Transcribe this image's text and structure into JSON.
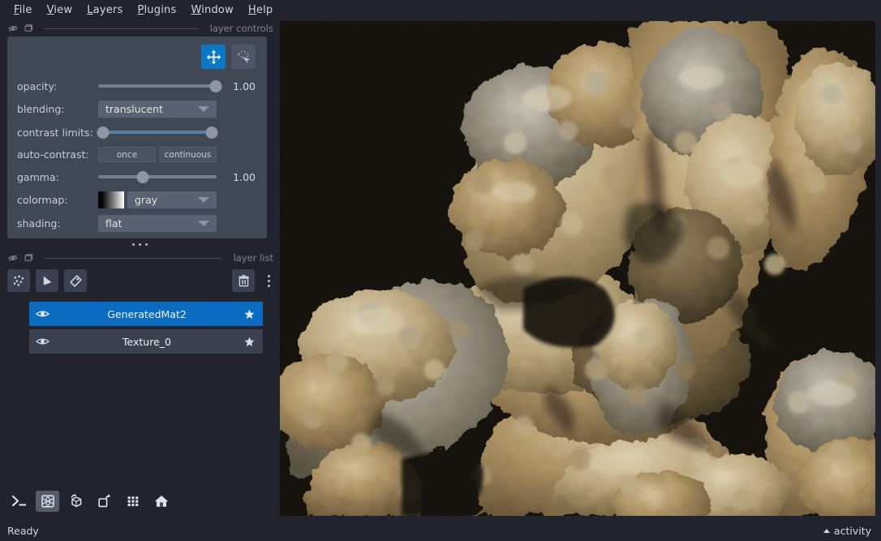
{
  "app": {
    "status_left": "Ready",
    "activity_label": "activity",
    "accent_blue": "#0a7ac7",
    "selected_blue": "#0a6cc0",
    "panel_bg": "#414855",
    "window_bg": "#21242c"
  },
  "menubar": {
    "items": [
      {
        "label": "File",
        "mnemonic": "F",
        "rest": "ile"
      },
      {
        "label": "View",
        "mnemonic": "V",
        "rest": "iew"
      },
      {
        "label": "Layers",
        "mnemonic": "L",
        "rest": "ayers"
      },
      {
        "label": "Plugins",
        "mnemonic": "P",
        "rest": "lugins"
      },
      {
        "label": "Window",
        "mnemonic": "W",
        "rest": "indow"
      },
      {
        "label": "Help",
        "mnemonic": "H",
        "rest": "elp"
      }
    ]
  },
  "layer_controls": {
    "dock_title": "layer controls",
    "dock_icons": [
      "float-window-icon",
      "dock-window-icon"
    ],
    "modes": [
      {
        "name": "pan-zoom-mode-button",
        "icon": "move-arrows-icon",
        "active": true
      },
      {
        "name": "transform-mode-button",
        "icon": "transform-select-icon",
        "active": false
      }
    ],
    "opacity": {
      "label": "opacity:",
      "value": "1.00",
      "fraction": 1.0
    },
    "blending": {
      "label": "blending:",
      "value": "translucent"
    },
    "contrast_limits": {
      "label": "contrast limits:",
      "low_fraction": 0.0,
      "high_fraction": 1.0
    },
    "auto_contrast": {
      "label": "auto-contrast:",
      "once": "once",
      "continuous": "continuous"
    },
    "gamma": {
      "label": "gamma:",
      "value": "1.00",
      "fraction": 0.375
    },
    "colormap": {
      "label": "colormap:",
      "value": "gray"
    },
    "shading": {
      "label": "shading:",
      "value": "flat"
    }
  },
  "layer_list": {
    "dock_title": "layer list",
    "dock_icons": [
      "float-window-icon",
      "dock-window-icon"
    ],
    "toolbar": [
      {
        "name": "new-points-layer-button",
        "icon": "points-icon"
      },
      {
        "name": "new-shapes-layer-button",
        "icon": "shapes-icon"
      },
      {
        "name": "new-labels-layer-button",
        "icon": "labels-tag-icon"
      }
    ],
    "delete_button": {
      "name": "delete-layer-button",
      "icon": "trash-icon"
    },
    "overflow_button": {
      "name": "layer-list-menu-button",
      "icon": "kebab-menu-icon"
    },
    "layers": [
      {
        "name": "GeneratedMat2",
        "selected": true,
        "visible": true,
        "pinned": true
      },
      {
        "name": "Texture_0",
        "selected": false,
        "visible": true,
        "pinned": true
      }
    ]
  },
  "viewer_buttons": [
    {
      "name": "console-button",
      "icon": "terminal-icon",
      "active": false
    },
    {
      "name": "ndisplay-toggle-button",
      "icon": "cube-3d-icon",
      "active": true
    },
    {
      "name": "roll-dims-button",
      "icon": "roll-cube-icon",
      "active": false
    },
    {
      "name": "transpose-dims-button",
      "icon": "transpose-icon",
      "active": false
    },
    {
      "name": "grid-view-button",
      "icon": "grid-icon",
      "active": false
    },
    {
      "name": "reset-view-button",
      "icon": "home-icon",
      "active": false
    }
  ],
  "canvas": {
    "name": "viewer-canvas",
    "background": "#000000",
    "content": "3D textured coral / rock mesh render"
  }
}
